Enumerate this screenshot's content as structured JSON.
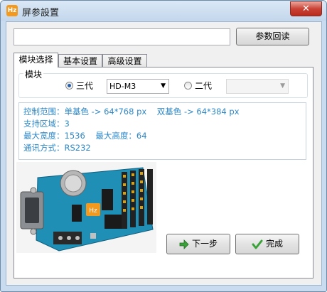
{
  "window": {
    "title": "屏参設置",
    "app_icon_text": "Hz",
    "close_glyph": "✕"
  },
  "top": {
    "input_value": "",
    "readback_label": "参数回读"
  },
  "tabs": [
    {
      "label": "模块选择",
      "active": true
    },
    {
      "label": "基本设置",
      "active": false
    },
    {
      "label": "高级设置",
      "active": false
    }
  ],
  "module": {
    "group_label": "模块",
    "gen3_label": "三代",
    "gen3_checked": true,
    "gen3_selected": "HD-M3",
    "gen2_label": "二代",
    "gen2_checked": false,
    "gen2_selected": ""
  },
  "info": {
    "line1": "控制范围：单基色 -> 64*768 px    双基色 -> 64*384 px",
    "line2": "支持区域：3",
    "line3": "最大宽度：1536    最大高度：64",
    "line4": "通讯方式：RS232"
  },
  "buttons": {
    "next_label": "下一步",
    "finish_label": "完成"
  },
  "colors": {
    "info_text": "#2e88c8",
    "pcb_board": "#1f8fb6",
    "logo_orange": "#f39a1e",
    "next_arrow": "#3aa23a",
    "finish_check": "#3aa23a"
  },
  "icons": {
    "next": "right-arrow-icon",
    "finish": "checkmark-icon",
    "combo": "chevron-down-icon"
  }
}
